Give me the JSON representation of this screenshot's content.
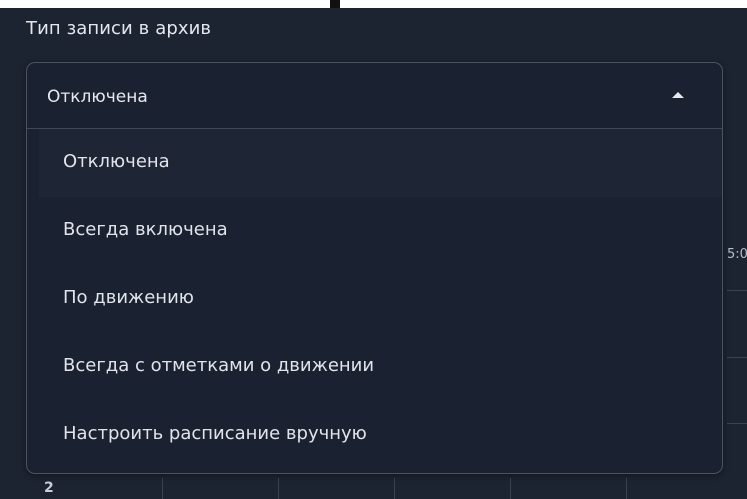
{
  "field": {
    "label": "Тип записи в архив",
    "selected_value": "Отключена",
    "caret_icon": "caret-up-icon"
  },
  "options": [
    {
      "label": "Отключена",
      "selected": true
    },
    {
      "label": "Всегда включена",
      "selected": false
    },
    {
      "label": "По движению",
      "selected": false
    },
    {
      "label": "Всегда с отметками о движении",
      "selected": false
    },
    {
      "label": "Настроить расписание вручную",
      "selected": false
    }
  ],
  "background": {
    "time_fragment": "5:0",
    "row_number_fragment": "2"
  },
  "colors": {
    "page_background": "#1c2331",
    "dropdown_background": "#1a2130",
    "border": "#4a5366",
    "text": "#e6e9ef"
  }
}
